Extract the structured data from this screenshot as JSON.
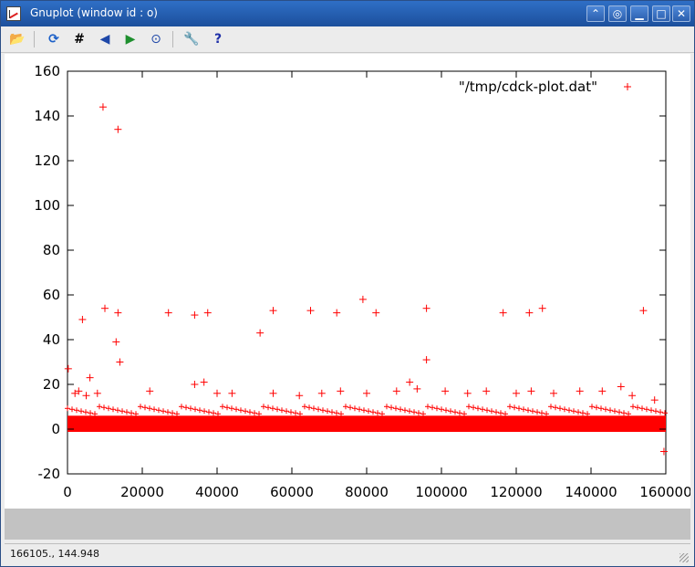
{
  "window": {
    "title": "Gnuplot (window id : o)",
    "buttons": {
      "shade": "⌃",
      "restore": "◎",
      "minimize": "▁",
      "maximize": "□",
      "close": "✕"
    }
  },
  "toolbar": {
    "icons": [
      "open-icon",
      "replot-icon",
      "grid-icon",
      "zoom-previous-icon",
      "zoom-next-icon",
      "autoscale-icon",
      "options-icon",
      "help-icon"
    ],
    "glyphs": [
      "📂",
      "⟳",
      "#",
      "◀",
      "▶",
      "⊙",
      "🔧",
      "?"
    ]
  },
  "status": {
    "coords": "166105.,  144.948"
  },
  "colors": {
    "series": "#ff0000",
    "titlebar": "#1c4f9c"
  },
  "chart_data": {
    "type": "scatter",
    "title": "",
    "xlabel": "",
    "ylabel": "",
    "xlim": [
      0,
      160000
    ],
    "ylim": [
      -20,
      160
    ],
    "xticks": [
      "0",
      "20000",
      "40000",
      "60000",
      "80000",
      "100000",
      "120000",
      "140000",
      "160000"
    ],
    "yticks": [
      "-20",
      "0",
      "20",
      "40",
      "60",
      "80",
      "100",
      "120",
      "140",
      "160"
    ],
    "xtick_values": [
      0,
      20000,
      40000,
      60000,
      80000,
      100000,
      120000,
      140000,
      160000
    ],
    "ytick_values": [
      -20,
      0,
      20,
      40,
      60,
      80,
      100,
      120,
      140,
      160
    ],
    "legend": {
      "label": "\"/tmp/cdck-plot.dat\"",
      "position": "top-right"
    },
    "grid": false,
    "series": [
      {
        "name": "\"/tmp/cdck-plot.dat\"",
        "band": {
          "x_range": [
            0,
            160000
          ],
          "y_range": [
            0,
            6
          ]
        },
        "points": [
          [
            9500,
            144
          ],
          [
            13500,
            134
          ],
          [
            4000,
            49
          ],
          [
            10000,
            54
          ],
          [
            13500,
            52
          ],
          [
            13000,
            39
          ],
          [
            14000,
            30
          ],
          [
            200,
            27
          ],
          [
            6000,
            23
          ],
          [
            27000,
            52
          ],
          [
            34000,
            51
          ],
          [
            37500,
            52
          ],
          [
            51500,
            43
          ],
          [
            55000,
            53
          ],
          [
            65000,
            53
          ],
          [
            72000,
            52
          ],
          [
            79000,
            58
          ],
          [
            82500,
            52
          ],
          [
            96000,
            54
          ],
          [
            96000,
            31
          ],
          [
            116500,
            52
          ],
          [
            123500,
            52
          ],
          [
            127000,
            54
          ],
          [
            154000,
            53
          ],
          [
            159500,
            -10
          ],
          [
            34000,
            20
          ],
          [
            36500,
            21
          ],
          [
            91500,
            21
          ],
          [
            93500,
            18
          ],
          [
            148000,
            19
          ],
          [
            2000,
            16
          ],
          [
            3000,
            17
          ],
          [
            5000,
            15
          ],
          [
            8000,
            16
          ],
          [
            22000,
            17
          ],
          [
            40000,
            16
          ],
          [
            44000,
            16
          ],
          [
            55000,
            16
          ],
          [
            62000,
            15
          ],
          [
            68000,
            16
          ],
          [
            73000,
            17
          ],
          [
            80000,
            16
          ],
          [
            88000,
            17
          ],
          [
            101000,
            17
          ],
          [
            107000,
            16
          ],
          [
            112000,
            17
          ],
          [
            120000,
            16
          ],
          [
            124000,
            17
          ],
          [
            130000,
            16
          ],
          [
            137000,
            17
          ],
          [
            143000,
            17
          ],
          [
            151000,
            15
          ],
          [
            157000,
            13
          ]
        ]
      }
    ]
  }
}
